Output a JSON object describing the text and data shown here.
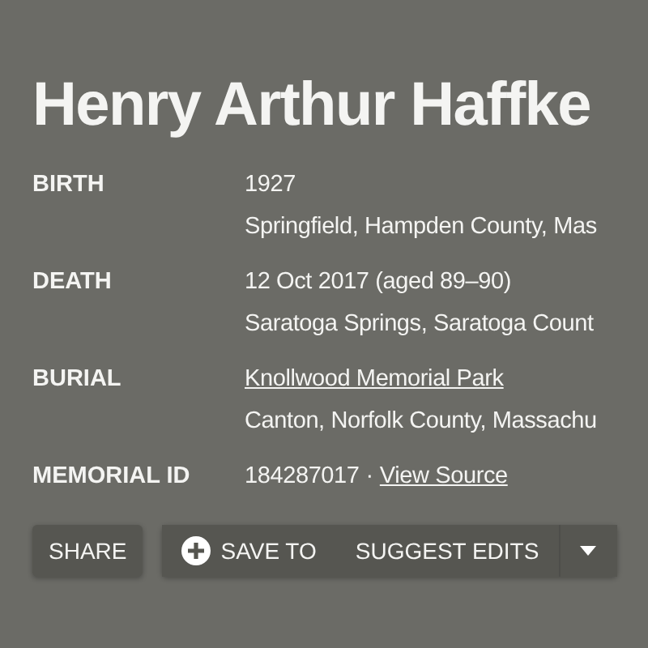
{
  "title": "Henry Arthur Haffke",
  "facts": [
    {
      "label": "BIRTH",
      "lines": [
        {
          "text": "1927",
          "link": false
        },
        {
          "text": "Springfield, Hampden County, Mas",
          "link": false
        }
      ]
    },
    {
      "label": "DEATH",
      "lines": [
        {
          "text": "12 Oct 2017 (aged 89–90)",
          "link": false
        },
        {
          "text": "Saratoga Springs, Saratoga Count",
          "link": false
        }
      ]
    },
    {
      "label": "BURIAL",
      "lines": [
        {
          "text": "Knollwood Memorial Park",
          "link": true
        },
        {
          "text": "Canton, Norfolk County, Massachu",
          "link": false
        }
      ]
    }
  ],
  "memorial": {
    "label": "MEMORIAL ID",
    "id": "184287017",
    "separator": "·",
    "link": "View Source"
  },
  "buttons": {
    "share": "SHARE",
    "save": "SAVE TO",
    "suggest": "SUGGEST EDITS"
  }
}
